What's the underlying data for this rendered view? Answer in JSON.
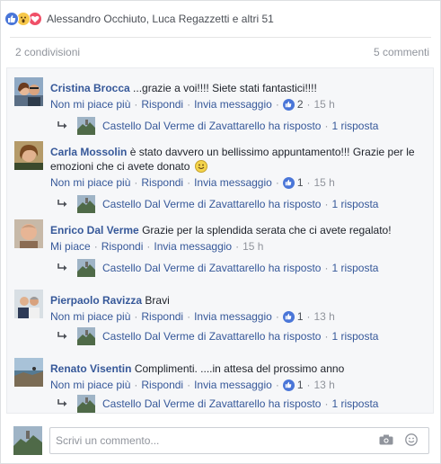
{
  "reactions": {
    "icons": [
      "like-icon",
      "wow-icon",
      "love-icon"
    ],
    "summary": "Alessandro Occhiuto, Luca Regazzetti e altri 51"
  },
  "stats": {
    "shares": "2 condivisioni",
    "comments": "5 commenti"
  },
  "comments": [
    {
      "author": "Cristina Brocca",
      "text": "...grazie a voi!!!! Siete stati fantastici!!!!",
      "like_action": "Non mi piace più",
      "reply_action": "Rispondi",
      "message_action": "Invia messaggio",
      "likes": "2",
      "time": "15 h",
      "reply_summary": "Castello Dal Verme di Zavattarello ha risposto",
      "reply_count": "1 risposta"
    },
    {
      "author": "Carla Mossolin",
      "text": "è stato davvero un bellissimo appuntamento!!! Grazie per le emozioni che ci avete donato",
      "like_action": "Non mi piace più",
      "reply_action": "Rispondi",
      "message_action": "Invia messaggio",
      "likes": "1",
      "time": "15 h",
      "reply_summary": "Castello Dal Verme di Zavattarello ha risposto",
      "reply_count": "1 risposta"
    },
    {
      "author": "Enrico Dal Verme",
      "text": "Grazie per la splendida serata che ci avete regalato!",
      "like_action": "Mi piace",
      "reply_action": "Rispondi",
      "message_action": "Invia messaggio",
      "likes": "",
      "time": "15 h",
      "reply_summary": "Castello Dal Verme di Zavattarello ha risposto",
      "reply_count": "1 risposta"
    },
    {
      "author": "Pierpaolo Ravizza",
      "text": "Bravi",
      "like_action": "Non mi piace più",
      "reply_action": "Rispondi",
      "message_action": "Invia messaggio",
      "likes": "1",
      "time": "13 h",
      "reply_summary": "Castello Dal Verme di Zavattarello ha risposto",
      "reply_count": "1 risposta"
    },
    {
      "author": "Renato Visentin",
      "text": "Complimenti. ....in attesa del prossimo anno",
      "like_action": "Non mi piace più",
      "reply_action": "Rispondi",
      "message_action": "Invia messaggio",
      "likes": "1",
      "time": "13 h",
      "reply_summary": "Castello Dal Verme di Zavattarello ha risposto",
      "reply_count": "1 risposta"
    }
  ],
  "composer": {
    "placeholder": "Scrivi un commento...",
    "icons": [
      "camera-icon",
      "emoji-icon"
    ]
  },
  "colors": {
    "link": "#365899",
    "meta": "#90949c",
    "like_blue": "#4a76d8",
    "love_red": "#f05068",
    "wow_yellow": "#f7c84a",
    "comments_bg": "#f6f7f9"
  }
}
